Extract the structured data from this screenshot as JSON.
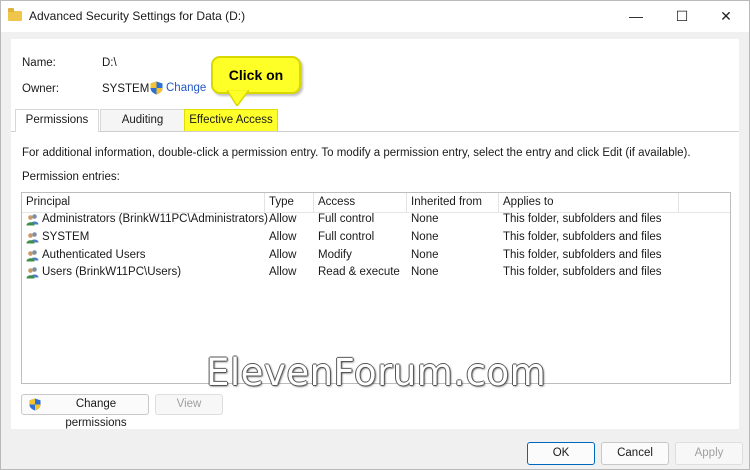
{
  "window": {
    "title": "Advanced Security Settings for Data (D:)",
    "minimize_glyph": "—",
    "maximize_glyph": "☐",
    "close_glyph": "✕"
  },
  "header": {
    "name_label": "Name:",
    "name_value": "D:\\",
    "owner_label": "Owner:",
    "owner_value": "SYSTEM",
    "change_link": "Change"
  },
  "callout": {
    "text": "Click on"
  },
  "tabs": [
    {
      "label": "Permissions",
      "active": true
    },
    {
      "label": "Auditing",
      "active": false
    },
    {
      "label": "Effective Access",
      "active": false,
      "highlighted": true
    }
  ],
  "info_text": "For additional information, double-click a permission entry. To modify a permission entry, select the entry and click Edit (if available).",
  "entries_label": "Permission entries:",
  "table": {
    "columns": [
      "Principal",
      "Type",
      "Access",
      "Inherited from",
      "Applies to"
    ],
    "rows": [
      [
        "Administrators (BrinkW11PC\\Administrators)",
        "Allow",
        "Full control",
        "None",
        "This folder, subfolders and files"
      ],
      [
        "SYSTEM",
        "Allow",
        "Full control",
        "None",
        "This folder, subfolders and files"
      ],
      [
        "Authenticated Users",
        "Allow",
        "Modify",
        "None",
        "This folder, subfolders and files"
      ],
      [
        "Users (BrinkW11PC\\Users)",
        "Allow",
        "Read & execute",
        "None",
        "This folder, subfolders and files"
      ]
    ]
  },
  "buttons": {
    "change_permissions": "Change permissions",
    "view": "View",
    "ok": "OK",
    "cancel": "Cancel",
    "apply": "Apply"
  },
  "watermark": "ElevenForum.com",
  "colors": {
    "accent": "#0067c0",
    "link": "#2458c6",
    "highlight": "#ffff28"
  },
  "icons": {
    "shield": "uac-shield-icon",
    "user": "user-group-icon",
    "folder": "folder-icon"
  }
}
